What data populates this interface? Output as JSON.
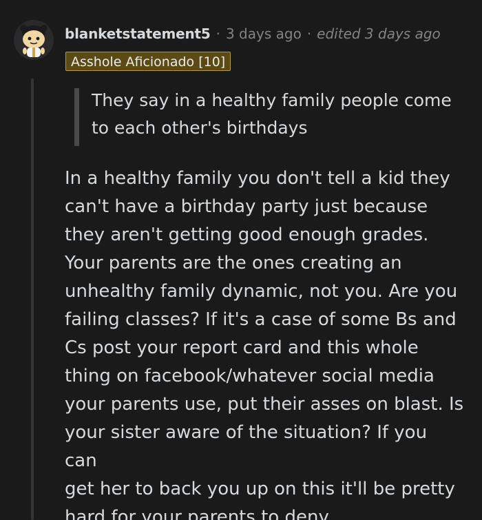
{
  "comment": {
    "author": "blanketstatement5",
    "separator": "·",
    "time": "3 days ago",
    "edited": "edited 3 days ago",
    "flair": "Asshole Aficionado [10]",
    "avatar_icon": "snoo-avatar-icon",
    "quote_lines": [
      "They say in a healthy family people come",
      "to each other's birthdays"
    ],
    "body_lines": [
      "In a healthy family you don't tell a kid they",
      "can't have a birthday party just because",
      "they aren't getting good enough grades.",
      "Your parents are the ones creating an",
      "unhealthy family dynamic, not you. Are you",
      "failing classes? If it's a case of some Bs and",
      "Cs post your report card and this whole",
      "thing on facebook/whatever social media",
      "your parents use, put their asses on blast. Is",
      "your sister aware of the situation? If you can",
      "get her to back you up on this it'll be pretty",
      "hard for your parents to deny."
    ]
  },
  "colors": {
    "background": "#1a1a1b",
    "text": "#d7dadc",
    "muted": "#818384",
    "flair_bg": "#5c4a15",
    "thread_line": "#343536"
  }
}
